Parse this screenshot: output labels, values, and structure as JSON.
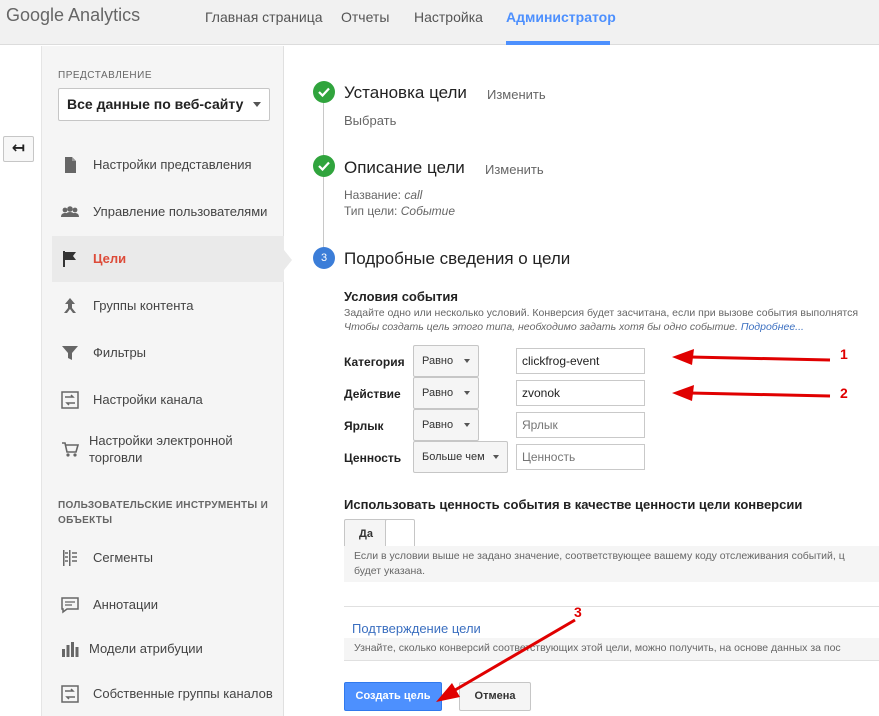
{
  "app": {
    "logo": "Google Analytics"
  },
  "nav": {
    "items": [
      {
        "label": "Главная страница"
      },
      {
        "label": "Отчеты"
      },
      {
        "label": "Настройка"
      },
      {
        "label": "Администратор"
      }
    ],
    "active_index": 3
  },
  "sidebar": {
    "back_glyph": "↤",
    "view_label": "ПРЕДСТАВЛЕНИЕ",
    "view_selected": "Все данные по веб-сайту",
    "items": [
      {
        "label": "Настройки представления",
        "icon": "document-icon"
      },
      {
        "label": "Управление пользователями",
        "icon": "users-icon"
      },
      {
        "label": "Цели",
        "icon": "flag-icon"
      },
      {
        "label": "Группы контента",
        "icon": "content-groups-icon"
      },
      {
        "label": "Фильтры",
        "icon": "filter-icon"
      },
      {
        "label": "Настройки канала",
        "icon": "channel-settings-icon"
      },
      {
        "label": "Настройки электронной торговли",
        "icon": "cart-icon"
      }
    ],
    "tools_section_label": "ПОЛЬЗОВАТЕЛЬСКИЕ ИНСТРУМЕНТЫ И ОБЪЕКТЫ",
    "tools_items": [
      {
        "label": "Сегменты",
        "icon": "segments-icon"
      },
      {
        "label": "Аннотации",
        "icon": "annotations-icon"
      },
      {
        "label": "Модели атрибуции",
        "icon": "attribution-icon"
      },
      {
        "label": "Собственные группы каналов",
        "icon": "channel-groups-icon"
      }
    ]
  },
  "steps": {
    "step1": {
      "title": "Установка цели",
      "edit": "Изменить",
      "value": "Выбрать"
    },
    "step2": {
      "title": "Описание цели",
      "edit": "Изменить",
      "name_label": "Название:",
      "name_value": "call",
      "type_label": "Тип цели:",
      "type_value": "Событие"
    },
    "step3": {
      "number": "3",
      "title": "Подробные сведения о цели"
    }
  },
  "conditions": {
    "title": "Условия события",
    "description": "Задайте одно или несколько условий. Конверсия будет засчитана, если при вызове события выполнятся",
    "hint": "Чтобы создать цель этого типа, необходимо задать хотя бы одно событие.",
    "more_link": "Подробнее...",
    "rows": [
      {
        "label": "Категория",
        "operator": "Равно",
        "value": "clickfrog-event",
        "placeholder": ""
      },
      {
        "label": "Действие",
        "operator": "Равно",
        "value": "zvonok",
        "placeholder": ""
      },
      {
        "label": "Ярлык",
        "operator": "Равно",
        "value": "",
        "placeholder": "Ярлык"
      },
      {
        "label": "Ценность",
        "operator": "Больше чем",
        "value": "",
        "placeholder": "Ценность"
      }
    ]
  },
  "use_value": {
    "title": "Использовать ценность события в качестве ценности цели конверсии",
    "toggle_label": "Да",
    "note": "Если в условии выше не задано значение, соответствующее вашему коду отслеживания событий, ц",
    "note2": "будет указана."
  },
  "verify": {
    "link": "Подтверждение цели",
    "description": "Узнайте, сколько конверсий соответствующих этой цели, можно получить, на основе данных за пос"
  },
  "actions": {
    "create": "Создать цель",
    "cancel": "Отмена"
  },
  "annotations": {
    "n1": "1",
    "n2": "2",
    "n3": "3",
    "color": "#e00000"
  },
  "colors": {
    "accent": "#4d90fe",
    "active_item": "#dd4b39",
    "check": "#30a43d",
    "link": "#3b6fc0"
  }
}
